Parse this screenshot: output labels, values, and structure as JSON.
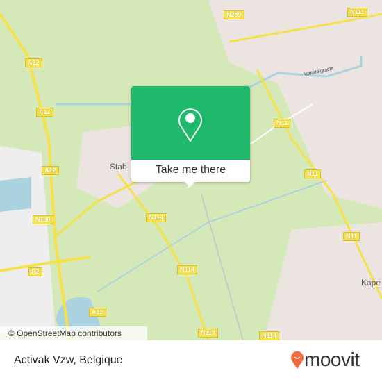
{
  "map": {
    "road_labels": [
      "N289",
      "N111",
      "A12",
      "A12",
      "A12",
      "A12",
      "N11",
      "N11",
      "N11",
      "N180",
      "N114",
      "N114",
      "N114",
      "N114",
      "R2"
    ],
    "place_labels": [
      "Stab",
      "Kape"
    ],
    "waterway_label": "Antitankgracht",
    "attribution": "© OpenStreetMap contributors",
    "colors": {
      "land": "#d5e8b8",
      "urban": "#ece4e0",
      "water": "#aad3df",
      "major_road": "#f7e14a",
      "popup": "#1fb96b"
    }
  },
  "popup": {
    "icon": "map-pin-icon",
    "button_label": "Take me there"
  },
  "footer": {
    "title": "Activak Vzw, Belgique",
    "brand": "moovit",
    "brand_color": "#f26a3a"
  }
}
